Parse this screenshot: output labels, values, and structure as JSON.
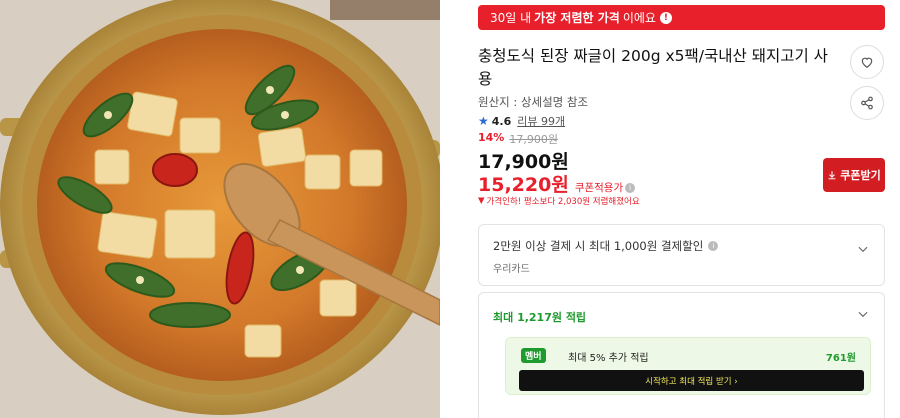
{
  "banner": {
    "prefix": "30일 내",
    "highlight": "가장 저렴한 가격",
    "suffix": "이에요"
  },
  "product": {
    "title": "충청도식 된장 짜글이 200g x5팩/국내산 돼지고기 사용",
    "origin": "원산지 : 상세설명 참조",
    "rating": "4.6",
    "review": "리뷰 99개"
  },
  "pricing": {
    "discount_pct": "14%",
    "original_price": "17,900원",
    "price": "17,900원",
    "coupon_price": "15,220원",
    "coupon_tag": "쿠폰적용가",
    "save_note": "가격인하! 평소보다 2,030원 저렴해졌어요",
    "coupon_button": "쿠폰받기"
  },
  "card_offer": {
    "line": "2만원 이상 결제 시 최대 1,000원 결제할인",
    "card_name": "우리카드"
  },
  "points": {
    "max": "최대 1,217원 적립",
    "member_badge": "멤버",
    "member_text": "최대 5% 추가 적립",
    "member_amount": "761원",
    "cta": "시작하고 최대 적립 받기 ›"
  },
  "icons": {
    "like": "heart-icon",
    "share": "share-icon",
    "download": "download-icon",
    "chevron": "chevron-down-icon"
  },
  "colors": {
    "accent_red": "#e8202b",
    "button_red": "#d21e23",
    "green": "#1f9a2e"
  }
}
